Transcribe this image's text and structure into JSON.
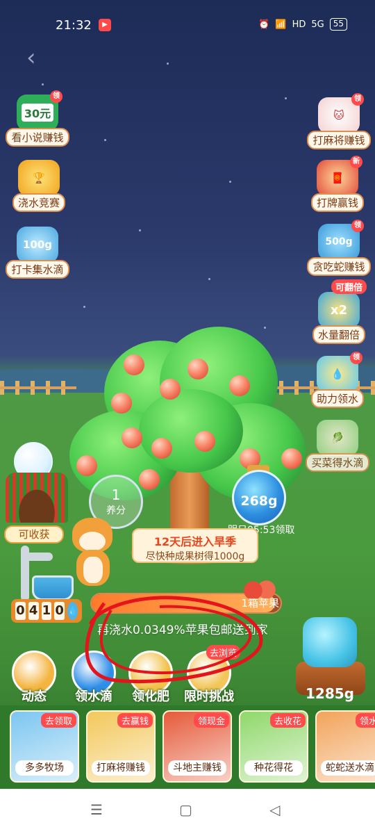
{
  "status": {
    "time": "21:32",
    "signal": "5G",
    "hd": "HD",
    "battery": "55"
  },
  "left_items": [
    {
      "icon_text": "30元",
      "label": "看小说赚钱",
      "icon": "cash-icon"
    },
    {
      "icon_text": "",
      "label": "浇水竞赛",
      "icon": "trophy-icon"
    },
    {
      "icon_text": "100g",
      "label": "打卡集水滴",
      "icon": "water-bottle-icon"
    }
  ],
  "right_items": [
    {
      "label": "打麻将赚钱",
      "icon": "fortune-cat-icon",
      "tag": "领"
    },
    {
      "label": "打牌赢钱",
      "icon": "god-of-wealth-icon",
      "tag": "新"
    },
    {
      "label": "贪吃蛇赚钱",
      "icon_text": "500g",
      "icon": "snake-icon",
      "tag": "领"
    },
    {
      "label": "水量翻倍",
      "icon_text": "x2",
      "icon": "double-icon",
      "pill": "可翻倍"
    },
    {
      "label": "助力领水",
      "icon": "help-water-icon",
      "tag": "领"
    },
    {
      "label": "买菜得水滴",
      "icon": "vegetable-icon"
    }
  ],
  "farm": {
    "harvest_label": "可收获",
    "nutrient": {
      "value": "1",
      "label": "养分"
    },
    "counter_digits": [
      "0",
      "4",
      "1",
      "0"
    ],
    "water_jar": {
      "amount": "268g",
      "note": "明日05:53领取"
    },
    "notice": {
      "line1": "12天后进入旱季",
      "line2": "尽快种成果树得1000g"
    },
    "progress": {
      "fraction": 0.97,
      "label": "1箱苹果"
    },
    "hint": "再浇水0.0349%苹果包邮送到家"
  },
  "actions": [
    {
      "label": "动态",
      "color": "#f4b440"
    },
    {
      "label": "领水滴",
      "color": "#2f8ee8"
    },
    {
      "label": "领化肥",
      "color": "#f0c24a"
    },
    {
      "label": "限时挑战",
      "color": "#f2c65a",
      "tag": "去浏览"
    }
  ],
  "watering_can": {
    "amount": "1285g"
  },
  "cards": [
    {
      "tag": "去领取",
      "label": "多多牧场",
      "color": "#7bc6f0"
    },
    {
      "tag": "去赢钱",
      "label": "打麻将赚钱",
      "color": "#f3c85a"
    },
    {
      "tag": "领现金",
      "label": "斗地主赚钱",
      "color": "#e65a3a"
    },
    {
      "tag": "去收花",
      "label": "种花得花",
      "color": "#8fd86a"
    },
    {
      "tag": "领水",
      "label": "蛇蛇送水滴",
      "color": "#f2a35a"
    }
  ],
  "nav": {
    "menu": "☰",
    "home": "▢",
    "back": "◁"
  }
}
